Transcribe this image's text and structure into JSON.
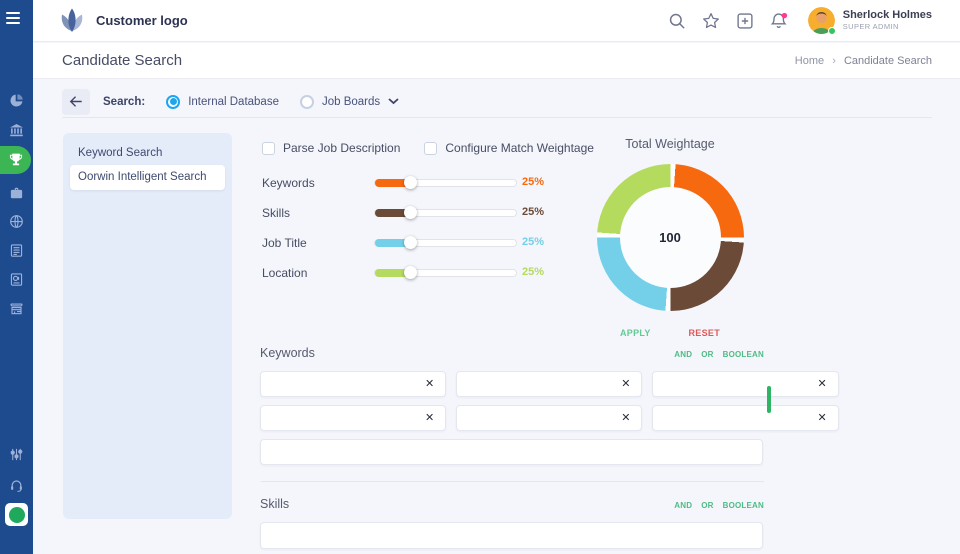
{
  "chart_data": {
    "type": "pie",
    "title": "Total Weightage",
    "labels": [
      "Keywords",
      "Skills",
      "Job Title",
      "Location"
    ],
    "values": [
      25,
      25,
      25,
      25
    ],
    "colors": [
      "#f7690e",
      "#6b4a38",
      "#74cfe9",
      "#b4da5e"
    ],
    "center_label": "100",
    "hole_ratio": 0.68,
    "legend": "none"
  },
  "sidebar": {
    "background": "#1e4b8e",
    "active_color": "#3cb554",
    "items": [
      {
        "icon": "pie-chart",
        "active": false
      },
      {
        "icon": "bank",
        "active": false
      },
      {
        "icon": "trophy",
        "active": true
      },
      {
        "icon": "briefcase",
        "active": false
      },
      {
        "icon": "globe",
        "active": false
      },
      {
        "icon": "newspaper",
        "active": false
      },
      {
        "icon": "blog",
        "active": false
      },
      {
        "icon": "storefront",
        "active": false
      },
      {
        "icon": "sliders",
        "active": false
      },
      {
        "icon": "headset",
        "active": false
      },
      {
        "icon": "chat-widget",
        "active": false
      }
    ]
  },
  "topbar": {
    "logo_text": "Customer logo",
    "user": {
      "name": "Sherlock Holmes",
      "role": "SUPER ADMIN"
    }
  },
  "page_header": {
    "title": "Candidate Search",
    "breadcrumb": {
      "home": "Home",
      "separator": "›",
      "current": "Candidate Search"
    }
  },
  "search_bar": {
    "label": "Search:",
    "options": [
      {
        "label": "Internal Database",
        "selected": true
      },
      {
        "label": "Job Boards",
        "selected": false,
        "has_dropdown": true
      }
    ]
  },
  "left_panel": {
    "items": [
      {
        "label": "Keyword Search",
        "selected": false
      },
      {
        "label": "Oorwin Intelligent Search",
        "selected": true
      }
    ]
  },
  "weightage": {
    "checkboxes": [
      {
        "label": "Parse Job Description",
        "checked": false
      },
      {
        "label": "Configure Match Weightage",
        "checked": false
      }
    ],
    "sliders": [
      {
        "label": "Keywords",
        "value": 25,
        "display": "25%",
        "color": "#f7690e"
      },
      {
        "label": "Skills",
        "value": 25,
        "display": "25%",
        "color": "#6b4a38"
      },
      {
        "label": "Job Title",
        "value": 25,
        "display": "25%",
        "color": "#74cfe9"
      },
      {
        "label": "Location",
        "value": 25,
        "display": "25%",
        "color": "#b4da5e"
      }
    ],
    "total": "100",
    "apply_label": "APPLY",
    "reset_label": "RESET"
  },
  "keywords_section": {
    "title": "Keywords",
    "operators": [
      "AND",
      "OR",
      "BOOLEAN"
    ],
    "chip_values": [
      "",
      "",
      "",
      "",
      "",
      ""
    ],
    "free_text_value": ""
  },
  "skills_section": {
    "title": "Skills",
    "operators": [
      "AND",
      "OR",
      "BOOLEAN"
    ],
    "free_text_value": ""
  },
  "colors": {
    "accent_green": "#4fbc85",
    "apply_green": "#62ca93",
    "reset_red": "#df5858",
    "radio_blue": "#1ea5ee",
    "scrollbar_green": "#2eb563",
    "sidebar_blue": "#1e4b8e"
  }
}
